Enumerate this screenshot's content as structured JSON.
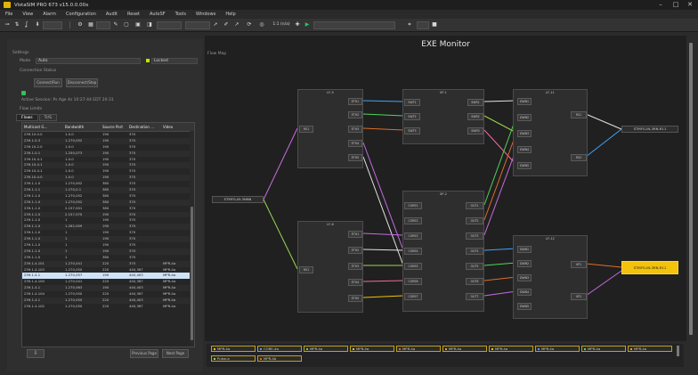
{
  "window": {
    "title": "VistaSIM PRO 673 v15.0.0.00x",
    "controls": [
      "–",
      "□",
      "✕"
    ]
  },
  "menu": [
    "File",
    "View",
    "Alarm",
    "Configuration",
    "Audit",
    "Reset",
    "AutoSF",
    "Tools",
    "Windows",
    "Help"
  ],
  "toolbar": {
    "zoom_label": "1:1 (n/a)"
  },
  "left": {
    "section_label": "Settings",
    "field_label": "Mode",
    "field_value": "Auto",
    "status_value": "Locked",
    "connection_label": "Connection Status",
    "btn_connect": "Connect/Run",
    "btn_disconnect": "Disconnect/Stop",
    "status_line": "Active Session: Ps Age 4s 10:27:44 EDT 20:31",
    "filters_label": "Flow Limits",
    "tabs": [
      "Flows",
      "Tr/S"
    ],
    "columns": [
      "Multicast G...",
      "Bandwidth",
      "Source Port",
      "Destination ...",
      "Video"
    ],
    "rows": [
      [
        "239.10.0.0",
        "1.0.0",
        "190",
        "370",
        ""
      ],
      [
        "239.1.0.3",
        "1.270,052",
        "190",
        "370",
        ""
      ],
      [
        "239.10.2.0",
        "1.0.0",
        "190",
        "370",
        ""
      ],
      [
        "239.1.0.1",
        "1.250,073",
        "190",
        "370",
        ""
      ],
      [
        "239.10.4.1",
        "1.0.0",
        "190",
        "370",
        ""
      ],
      [
        "239.10.4.1",
        "1.0.0",
        "190",
        "370",
        ""
      ],
      [
        "239.10.4.1",
        "1.0.0",
        "190",
        "370",
        ""
      ],
      [
        "239.10.4.0",
        "1.0.0",
        "190",
        "370",
        ""
      ],
      [
        "239.1.1.0",
        "1.270,002",
        "380",
        "370",
        ""
      ],
      [
        "239.1.1.1",
        "1.270,0.1",
        "380",
        "370",
        ""
      ],
      [
        "239.1.1.0",
        "1.270,052",
        "380",
        "370",
        ""
      ],
      [
        "239.1.1.0",
        "1.270,052",
        "380",
        "370",
        ""
      ],
      [
        "239.1.1.0",
        "2.157,001",
        "380",
        "370",
        ""
      ],
      [
        "239.1.1.0",
        "2.157,070",
        "190",
        "370",
        ""
      ],
      [
        "239.1.1.0",
        "1",
        "190",
        "370",
        ""
      ],
      [
        "239.1.1.0",
        "1.262,009",
        "190",
        "370",
        ""
      ],
      [
        "239.1.1.0",
        "1",
        "190",
        "370",
        ""
      ],
      [
        "239.1.1.0",
        "1",
        "190",
        "370",
        ""
      ],
      [
        "239.1.1.0",
        "1",
        "190",
        "370",
        ""
      ],
      [
        "239.1.1.0",
        "1",
        "190",
        "370",
        ""
      ],
      [
        "239.1.1.0",
        "1",
        "380",
        "370",
        ""
      ],
      [
        "239.1.4.101",
        "1.270,041",
        "220",
        "370",
        "MPR-4a"
      ],
      [
        "239.1.4.103",
        "1.270,050",
        "220",
        "440,367",
        "MPR-4a"
      ],
      [
        "239.1.4.1",
        "1.270,057",
        "190",
        "440,403",
        "MPR-4a"
      ],
      [
        "239.1.4.100",
        "1.270,041",
        "220",
        "440,367",
        "MPR-4a"
      ],
      [
        "239.1.4.1",
        "1.270,063",
        "190",
        "440,403",
        "MPR-4a"
      ],
      [
        "239.1.4.104",
        "1.270,050",
        "220",
        "440,367",
        "MPR-4a"
      ],
      [
        "239.1.4.1",
        "1.270,050",
        "220",
        "440,403",
        "MPR-4a"
      ],
      [
        "239.1.4.102",
        "1.270,050",
        "220",
        "440,367",
        "MPR-4a"
      ]
    ],
    "selected_row": 23,
    "btn_export": "⇩",
    "btn_prev": "Previous Page",
    "btn_next": "Next Page"
  },
  "main": {
    "title": "EXE Monitor",
    "flow_label": "Flow Map",
    "source_endpoint": "STMFG-IN-3NNN",
    "dest_top": "STMFG-IN-3RN-R11",
    "dest_highlight": "STMFG-IN-3RN-R11",
    "nodes": [
      {
        "title": "LF-5",
        "ports": [
          "ETH1",
          "ETH2",
          "ETH3",
          "ETH4",
          "ETH5"
        ],
        "left_port": "RS1"
      },
      {
        "title": "LF-6",
        "ports": [
          "ETH1",
          "ETH2",
          "ETH3",
          "ETH4",
          "ETH5"
        ],
        "left_port": "RS1"
      },
      {
        "title": "SP-1",
        "left_ports": [
          "SWT1",
          "SWT2",
          "SWT3"
        ],
        "right_ports": [
          "SWR1",
          "SWR2",
          "SWR3"
        ]
      },
      {
        "title": "SP-2",
        "left_ports": [
          "CORE1",
          "CORE2",
          "CORE3",
          "CORE4",
          "CORE5",
          "CORE6",
          "CORE7"
        ],
        "right_ports": [
          "OUT1",
          "OUT2",
          "OUT3",
          "OUT4",
          "OUT5",
          "OUT6",
          "OUT7"
        ]
      },
      {
        "title": "LF-11",
        "ports": [
          "DWN1",
          "DWN2",
          "DWN3",
          "DWN4",
          "DWN5"
        ],
        "right_ports": [
          "RS1",
          "RS2"
        ]
      },
      {
        "title": "LF-12",
        "ports": [
          "DWN1",
          "DWN2",
          "DWN3",
          "DWN4",
          "DWN5"
        ],
        "right_ports": [
          "UP1",
          "UP2"
        ]
      }
    ]
  },
  "bottom": {
    "chips": [
      "MPR-4a",
      "CORE-4a",
      "MPR-4a",
      "MPR-4a",
      "MPR-4a",
      "MPR-4a",
      "MPR-4a",
      "MPR-4a",
      "MPR-4a",
      "MPR-4a"
    ],
    "chip_colors": [
      "#f0c400",
      "#3ea3ff",
      "#4fd65a",
      "#f0c400",
      "#e06d2a",
      "#e0a02a",
      "#f0c400",
      "#3ea3ff",
      "#4fd65a",
      "#e0a02a"
    ],
    "chips2": [
      "Pulse-a",
      "MPR-4b"
    ],
    "chips2_colors": [
      "#9bd64f",
      "#e06d2a"
    ]
  },
  "colors": {
    "accent": "#f2c20c",
    "status_ok": "#2ec25a"
  }
}
